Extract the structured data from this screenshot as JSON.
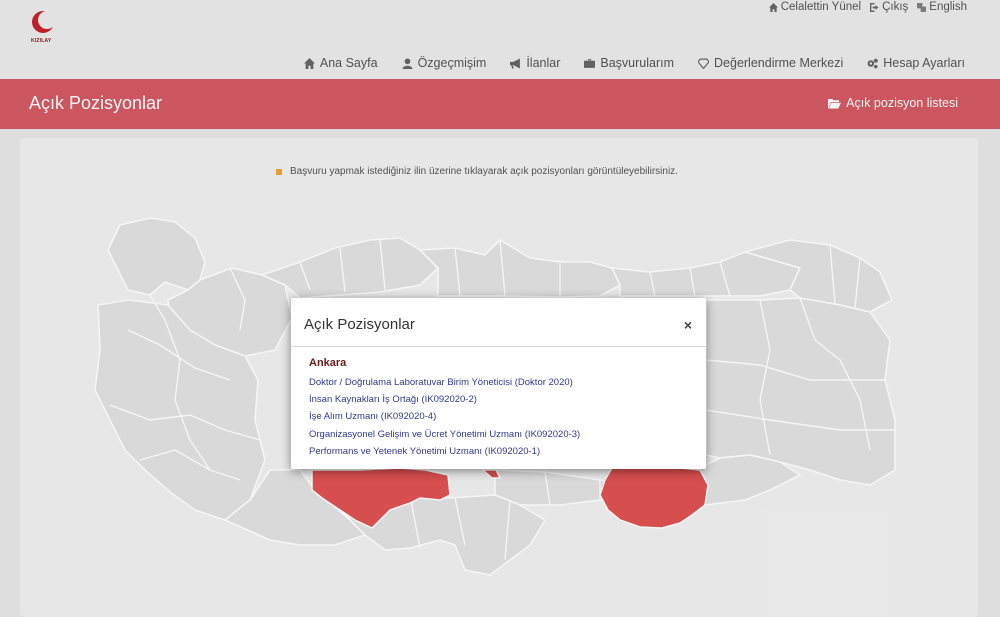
{
  "header": {
    "logo_text": "KIZILAY",
    "user_links": [
      {
        "icon": "home-icon",
        "label": "Celalettin Yünel"
      },
      {
        "icon": "sign-out-icon",
        "label": "Çıkış"
      },
      {
        "icon": "language-icon",
        "label": "English"
      }
    ],
    "nav": [
      {
        "icon": "home-icon",
        "label": "Ana Sayfa"
      },
      {
        "icon": "user-icon",
        "label": "Özgeçmişim"
      },
      {
        "icon": "bullhorn-icon",
        "label": "İlanlar"
      },
      {
        "icon": "briefcase-icon",
        "label": "Başvurularım"
      },
      {
        "icon": "diamond-icon",
        "label": "Değerlendirme Merkezi"
      },
      {
        "icon": "gears-icon",
        "label": "Hesap Ayarları"
      }
    ]
  },
  "titlebar": {
    "title": "Açık Pozisyonlar",
    "list_link": "Açık pozisyon listesi",
    "list_icon": "folder-open-icon"
  },
  "content": {
    "instruction": "Başvuru yapmak istediğiniz ilin üzerine tıklayarak açık pozisyonları görüntüleyebilirsiniz."
  },
  "modal": {
    "title": "Açık Pozisyonlar",
    "close_label": "×",
    "city": "Ankara",
    "positions": [
      "Doktor / Doğrulama Laboratuvar Birim Yöneticisi (Doktor 2020)",
      "İnsan Kaynakları İş Ortağı (IK092020-2)",
      "İşe Alım Uzmanı (IK092020-4)",
      "Organizasyonel Gelişim ve Ücret Yönetimi Uzmanı (IK092020-3)",
      "Performans ve Yetenek Yönetimi Uzmanı (IK092020-1)"
    ]
  },
  "colors": {
    "accent_red": "#d45a63",
    "highlight_province": "#e05252",
    "province_fill": "#e2e2e2",
    "province_border": "#ffffff",
    "bullet": "#e8a83a"
  }
}
